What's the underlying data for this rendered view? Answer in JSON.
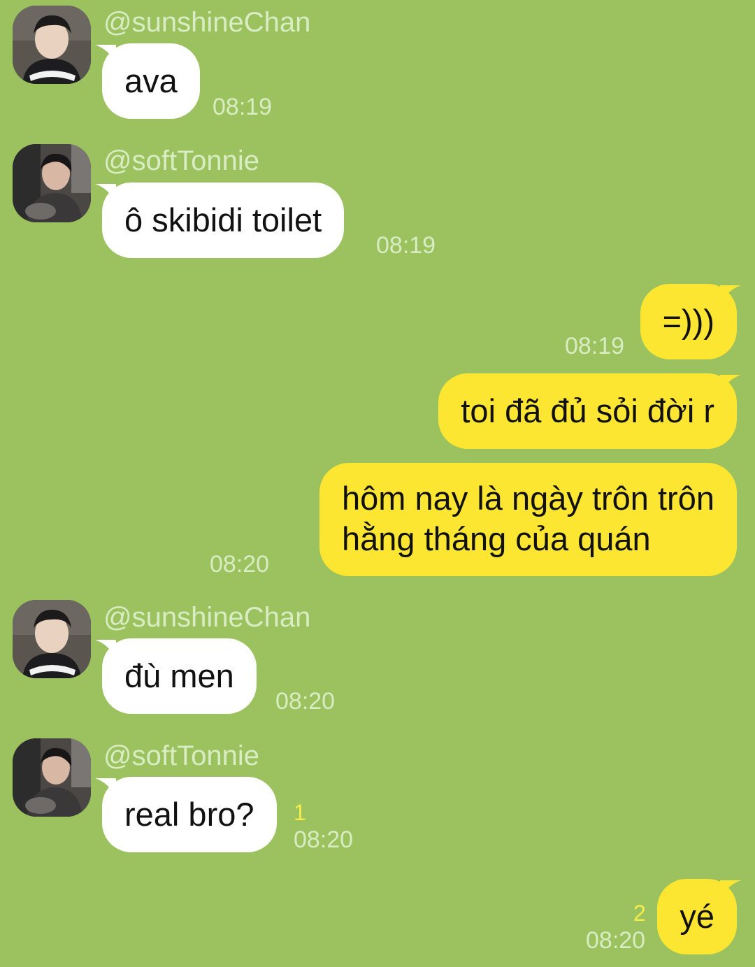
{
  "colors": {
    "background": "#9bc25e",
    "incoming_bubble": "#ffffff",
    "outgoing_bubble": "#fde631",
    "meta_text": "#d9ecc2",
    "unread_count": "#f4ec4a"
  },
  "messages": [
    {
      "direction": "in",
      "sender": "@sunshineChan",
      "avatar_icon": "profile-photo",
      "text": "ava",
      "time": "08:19"
    },
    {
      "direction": "in",
      "sender": "@softTonnie",
      "avatar_icon": "profile-photo",
      "text": "ô skibidi toilet",
      "time": "08:19"
    },
    {
      "direction": "out",
      "text": "=)))",
      "time": "08:19"
    },
    {
      "direction": "out",
      "text": "toi đã đủ sỏi đời r"
    },
    {
      "direction": "out",
      "text_lines": [
        "hôm nay là ngày trôn trôn",
        "hằng tháng của quán"
      ],
      "time": "08:20"
    },
    {
      "direction": "in",
      "sender": "@sunshineChan",
      "avatar_icon": "profile-photo",
      "text": "đù men",
      "time": "08:20"
    },
    {
      "direction": "in",
      "sender": "@softTonnie",
      "avatar_icon": "profile-photo",
      "text": "real bro?",
      "unread": "1",
      "time": "08:20"
    },
    {
      "direction": "out",
      "text": "yé",
      "unread": "2",
      "time": "08:20"
    }
  ]
}
